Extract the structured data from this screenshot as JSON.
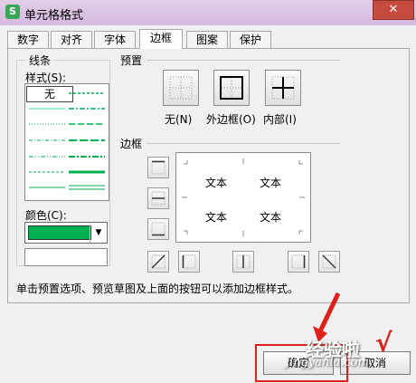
{
  "window": {
    "title": "单元格格式",
    "close_label": "✕",
    "app_icon_letter": "S"
  },
  "tabs": [
    "数字",
    "对齐",
    "字体",
    "边框",
    "图案",
    "保护"
  ],
  "active_tab": "边框",
  "line": {
    "group_label": "线条",
    "style_label": "样式(S):",
    "none_label": "无",
    "color_label": "颜色(C):",
    "color_value": "#00b050"
  },
  "presets": {
    "group_label": "预置",
    "items": [
      {
        "label": "无(N)",
        "icon": "border-none-icon"
      },
      {
        "label": "外边框(O)",
        "icon": "border-outline-icon"
      },
      {
        "label": "内部(I)",
        "icon": "border-inside-icon"
      }
    ]
  },
  "border": {
    "group_label": "边框",
    "preview_texts": [
      "文本",
      "文本",
      "文本",
      "文本"
    ]
  },
  "hint": "单击预置选项、预览草图及上面的按钮可以添加边框样式。",
  "buttons": {
    "ok": "确定",
    "cancel": "取消"
  },
  "watermark": {
    "text": "经验啦",
    "url": "jingyanla.com",
    "check": "√"
  }
}
